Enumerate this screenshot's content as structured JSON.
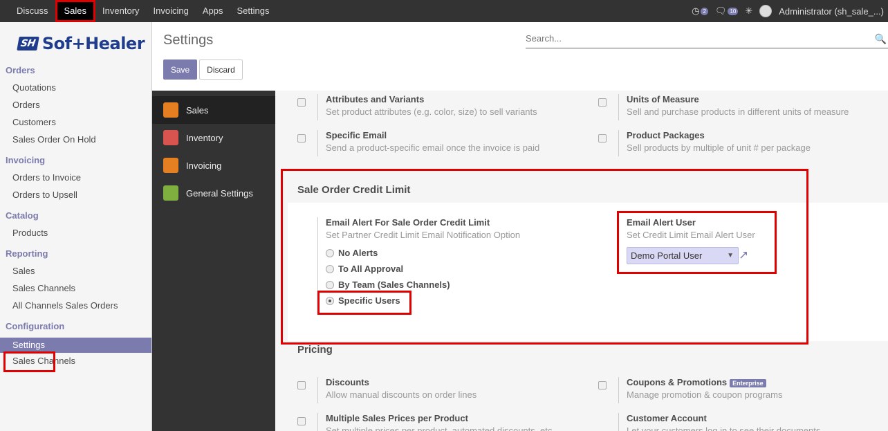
{
  "topbar": {
    "menu": [
      "Discuss",
      "Sales",
      "Inventory",
      "Invoicing",
      "Apps",
      "Settings"
    ],
    "activity_count": "2",
    "message_count": "10",
    "user": "Administrator (sh_sale_...)"
  },
  "brand": {
    "logo_text": "Sof+Healer",
    "logo_mark": "SH"
  },
  "sidebar": {
    "sections": [
      {
        "title": "Orders",
        "items": [
          "Quotations",
          "Orders",
          "Customers",
          "Sales Order On Hold"
        ]
      },
      {
        "title": "Invoicing",
        "items": [
          "Orders to Invoice",
          "Orders to Upsell"
        ]
      },
      {
        "title": "Catalog",
        "items": [
          "Products"
        ]
      },
      {
        "title": "Reporting",
        "items": [
          "Sales",
          "Sales Channels",
          "All Channels Sales Orders"
        ]
      },
      {
        "title": "Configuration",
        "items": [
          "Settings",
          "Sales Channels"
        ]
      }
    ],
    "selected": "Settings"
  },
  "header": {
    "title": "Settings",
    "search_placeholder": "Search...",
    "save_label": "Save",
    "discard_label": "Discard"
  },
  "apps": [
    {
      "label": "Sales",
      "color": "#e67e22",
      "active": true
    },
    {
      "label": "Inventory",
      "color": "#d9534f"
    },
    {
      "label": "Invoicing",
      "color": "#e67e22"
    },
    {
      "label": "General Settings",
      "color": "#7fb03f"
    }
  ],
  "settings": {
    "attributes": {
      "title": "Attributes and Variants",
      "desc": "Set product attributes (e.g. color, size) to sell variants"
    },
    "uom": {
      "title": "Units of Measure",
      "desc": "Sell and purchase products in different units of measure"
    },
    "specific_email": {
      "title": "Specific Email",
      "desc": "Send a product-specific email once the invoice is paid"
    },
    "packages": {
      "title": "Product Packages",
      "desc": "Sell products by multiple of unit # per package"
    },
    "credit_limit_section": "Sale Order Credit Limit",
    "email_alert": {
      "title": "Email Alert For Sale Order Credit Limit",
      "desc": "Set Partner Credit Limit Email Notification Option"
    },
    "radio_options": [
      "No Alerts",
      "To All Approval",
      "By Team (Sales Channels)",
      "Specific Users"
    ],
    "radio_selected": "Specific Users",
    "alert_user": {
      "title": "Email Alert User",
      "desc": "Set Credit Limit Email Alert User",
      "value": "Demo Portal User"
    },
    "pricing_section": "Pricing",
    "discounts": {
      "title": "Discounts",
      "desc": "Allow manual discounts on order lines"
    },
    "coupons": {
      "title": "Coupons & Promotions",
      "badge": "Enterprise",
      "desc": "Manage promotion & coupon programs"
    },
    "multi_prices": {
      "title": "Multiple Sales Prices per Product",
      "desc": "Set multiple prices per product, automated discounts, etc."
    },
    "customer_account": {
      "title": "Customer Account",
      "desc": "Let your customers log in to see their documents"
    }
  }
}
